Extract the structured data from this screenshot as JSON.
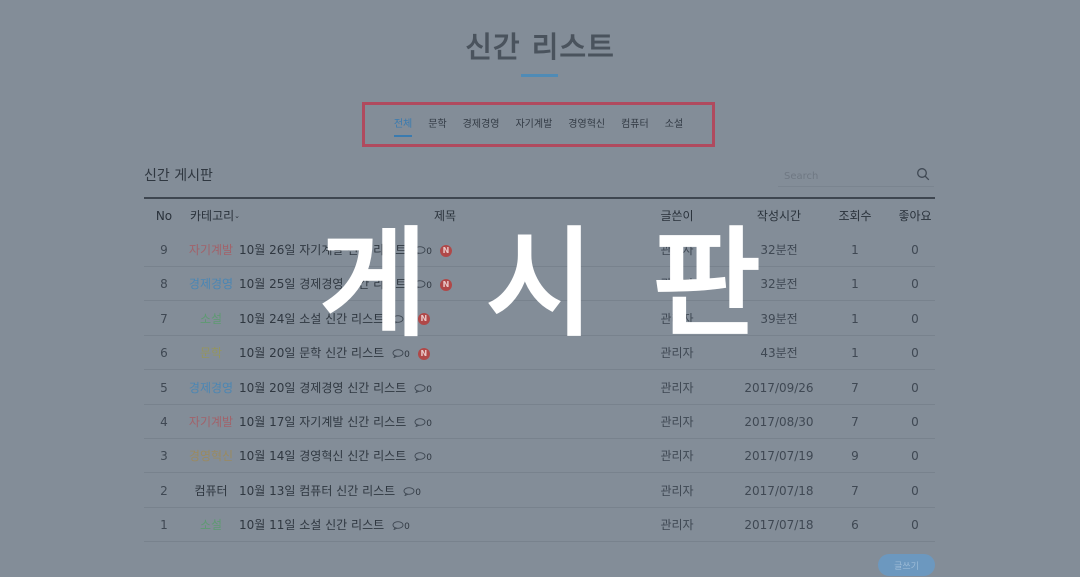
{
  "page": {
    "title": "신간 리스트"
  },
  "tabs": [
    {
      "label": "전체",
      "active": true
    },
    {
      "label": "문학"
    },
    {
      "label": "경제경영"
    },
    {
      "label": "자기계발"
    },
    {
      "label": "경영혁신"
    },
    {
      "label": "컴퓨터"
    },
    {
      "label": "소설"
    }
  ],
  "board": {
    "title": "신간 게시판",
    "search_placeholder": "Search",
    "write_label": "글쓰기"
  },
  "table": {
    "headers": {
      "no": "No",
      "category": "카테고리",
      "title": "제목",
      "author": "글쓴이",
      "time": "작성시간",
      "views": "조회수",
      "likes": "좋아요"
    },
    "rows": [
      {
        "no": "9",
        "category": "자기계발",
        "cat_color": "#a2626a",
        "title": "10월 26일 자기계발 신간 리스트",
        "comments": "0",
        "is_new": true,
        "new_label": "N",
        "author": "관리자",
        "time": "32분전",
        "views": "1",
        "likes": "0"
      },
      {
        "no": "8",
        "category": "경제경영",
        "cat_color": "#4a86b4",
        "title": "10월 25일 경제경영 신간 리스트",
        "comments": "0",
        "is_new": true,
        "new_label": "N",
        "author": "관리자",
        "time": "32분전",
        "views": "1",
        "likes": "0"
      },
      {
        "no": "7",
        "category": "소설",
        "cat_color": "#5e9a72",
        "title": "10월 24일 소설 신간 리스트",
        "comments": "0",
        "is_new": true,
        "new_label": "N",
        "author": "관리자",
        "time": "39분전",
        "views": "1",
        "likes": "0"
      },
      {
        "no": "6",
        "category": "문학",
        "cat_color": "#95955e",
        "title": "10월 20일 문학 신간 리스트",
        "comments": "0",
        "is_new": true,
        "new_label": "N",
        "author": "관리자",
        "time": "43분전",
        "views": "1",
        "likes": "0"
      },
      {
        "no": "5",
        "category": "경제경영",
        "cat_color": "#4a86b4",
        "title": "10월 20일 경제경영 신간 리스트",
        "comments": "0",
        "is_new": false,
        "author": "관리자",
        "time": "2017/09/26",
        "views": "7",
        "likes": "0"
      },
      {
        "no": "4",
        "category": "자기계발",
        "cat_color": "#a2626a",
        "title": "10월 17일 자기계발 신간 리스트",
        "comments": "0",
        "is_new": false,
        "author": "관리자",
        "time": "2017/08/30",
        "views": "7",
        "likes": "0"
      },
      {
        "no": "3",
        "category": "경영혁신",
        "cat_color": "#9b8a5e",
        "title": "10월 14일 경영혁신 신간 리스트",
        "comments": "0",
        "is_new": false,
        "author": "관리자",
        "time": "2017/07/19",
        "views": "9",
        "likes": "0"
      },
      {
        "no": "2",
        "category": "컴퓨터",
        "cat_color": "#2f3740",
        "title": "10월 13일 컴퓨터 신간 리스트",
        "comments": "0",
        "is_new": false,
        "author": "관리자",
        "time": "2017/07/18",
        "views": "7",
        "likes": "0"
      },
      {
        "no": "1",
        "category": "소설",
        "cat_color": "#5e9a72",
        "title": "10월 11일 소설 신간 리스트",
        "comments": "0",
        "is_new": false,
        "author": "관리자",
        "time": "2017/07/18",
        "views": "6",
        "likes": "0"
      }
    ]
  },
  "overlay": {
    "text": "게시판"
  },
  "colors": {
    "background": "#838d98",
    "accent": "#3a7bb0",
    "highlight_border": "#b04a5e",
    "new_badge": "#b04848"
  }
}
